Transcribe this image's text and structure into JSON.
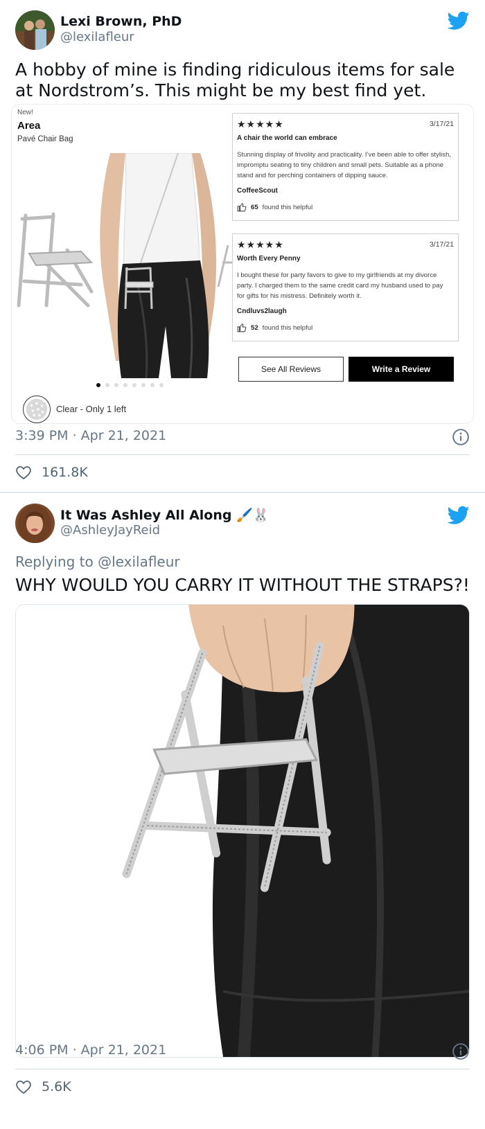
{
  "tweet1": {
    "author_name": "Lexi Brown, PhD",
    "author_handle": "@lexilafleur",
    "text": "A hobby of mine is finding ridiculous items for sale at Nordstrom’s. This might be my best find yet.",
    "timestamp": "3:39 PM · Apr 21, 2021",
    "likes": "161.8K",
    "embedded_listing": {
      "badge": "New!",
      "brand": "Area",
      "product": "Pavé Chair Bag",
      "swatch_label": "Clear - Only 1 left",
      "carousel_pages": 8,
      "carousel_active": 1,
      "reviews": [
        {
          "stars": "★★★★★",
          "date": "3/17/21",
          "title": "A chair the world can embrace",
          "body": "Stunning display of frivolity and practicality. I’ve been able to offer stylish, impromptu  seating to tiny children and small pets. Suitable as a phone stand and for perching containers of dipping sauce.",
          "author": "CoffeeScout",
          "helpful_count": "65",
          "helpful_text": "found this helpful"
        },
        {
          "stars": "★★★★★",
          "date": "3/17/21",
          "title": "Worth Every Penny",
          "body": "I bought these for party favors to give to my girlfriends at my divorce party.  I charged them to the same credit card my husband used to pay for gifts for his mistress.  Definitely worth it.",
          "author": "Cndluvs2laugh",
          "helpful_count": "52",
          "helpful_text": "found this helpful"
        }
      ],
      "see_all_label": "See All Reviews",
      "write_review_label": "Write a Review"
    }
  },
  "tweet2": {
    "author_name": "It Was Ashley All Along 🖌️🐰",
    "author_handle": "@AshleyJayReid",
    "replying_to": "Replying to @lexilafleur",
    "text": "WHY WOULD YOU CARRY IT WITHOUT THE STRAPS?!",
    "timestamp": "4:06 PM · Apr 21, 2021",
    "likes": "5.6K"
  },
  "colors": {
    "twitter_blue": "#1da1f2",
    "secondary_text": "#657786",
    "divider": "#e1e8ed"
  },
  "icons": [
    "twitter-bird-icon",
    "info-icon",
    "heart-icon",
    "thumbs-up-icon",
    "star-icon"
  ]
}
